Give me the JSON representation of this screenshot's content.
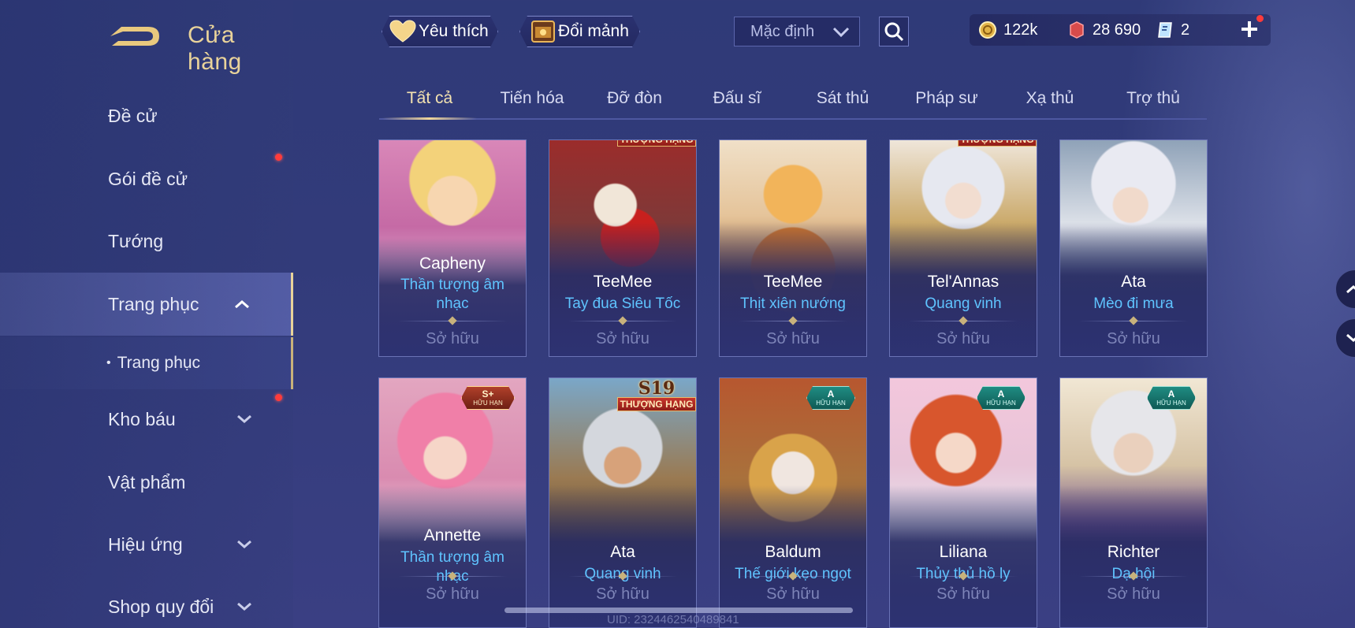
{
  "header": {
    "title": "Cửa hàng",
    "favorites_label": "Yêu thích",
    "exchange_label": "Đổi mảnh",
    "sort_value": "Mặc định"
  },
  "currency": {
    "gold": "122k",
    "vouchers": "28 690",
    "tickets": "2"
  },
  "sidebar": {
    "items": [
      {
        "label": "Đề cử"
      },
      {
        "label": "Gói đề cử"
      },
      {
        "label": "Tướng"
      },
      {
        "label": "Trang phục"
      },
      {
        "label": "Trang phục"
      },
      {
        "label": "Kho báu"
      },
      {
        "label": "Vật phẩm"
      },
      {
        "label": "Hiệu ứng"
      },
      {
        "label": "Shop quy đổi"
      }
    ],
    "sub_bullet": "•"
  },
  "tabs": [
    {
      "label": "Tất cả"
    },
    {
      "label": "Tiến hóa"
    },
    {
      "label": "Đỡ đòn"
    },
    {
      "label": "Đấu sĩ"
    },
    {
      "label": "Sát thủ"
    },
    {
      "label": "Pháp sư"
    },
    {
      "label": "Xạ thủ"
    },
    {
      "label": "Trợ thủ"
    }
  ],
  "skins": [
    {
      "hero": "Capheny",
      "skin": "Thần tượng âm nhạc",
      "status": "Sở hữu"
    },
    {
      "hero": "TeeMee",
      "skin": "Tay đua Siêu Tốc",
      "status": "Sở hữu",
      "badge": "THƯỢNG HẠNG"
    },
    {
      "hero": "TeeMee",
      "skin": "Thịt xiên nướng",
      "status": "Sở hữu"
    },
    {
      "hero": "Tel'Annas",
      "skin": "Quang vinh",
      "status": "Sở hữu",
      "badge": "THƯỢNG HẠNG"
    },
    {
      "hero": "Ata",
      "skin": "Mèo đi mưa",
      "status": "Sở hữu"
    },
    {
      "hero": "Annette",
      "skin": "Thần tượng âm nhạc",
      "status": "Sở hữu",
      "badge_top": "S+",
      "badge_bottom": "HỮU HẠN"
    },
    {
      "hero": "Ata",
      "skin": "Quang vinh",
      "status": "Sở hữu",
      "badge_top": "S19",
      "badge": "THƯỢNG HẠNG"
    },
    {
      "hero": "Baldum",
      "skin": "Thế giới kẹo ngọt",
      "status": "Sở hữu",
      "badge_top": "A",
      "badge_bottom": "HỮU HẠN"
    },
    {
      "hero": "Liliana",
      "skin": "Thủy thủ hồ ly",
      "status": "Sở hữu",
      "badge_top": "A",
      "badge_bottom": "HỮU HẠN"
    },
    {
      "hero": "Richter",
      "skin": "Dạ hội",
      "status": "Sở hữu",
      "badge_top": "A",
      "badge_bottom": "HỮU HẠN"
    }
  ],
  "footer": {
    "uid": "UID: 2324462540489841"
  },
  "colors": {
    "accent_gold": "#e9d39a",
    "skin_name_blue": "#5fc4ff",
    "notification_red": "#ff3b3b"
  },
  "icons": [
    "back-arrow-icon",
    "heart-icon",
    "chest-icon",
    "chevron-down-icon",
    "search-icon",
    "gold-coin-icon",
    "voucher-icon",
    "ticket-icon",
    "plus-icon",
    "chevron-up-icon"
  ]
}
